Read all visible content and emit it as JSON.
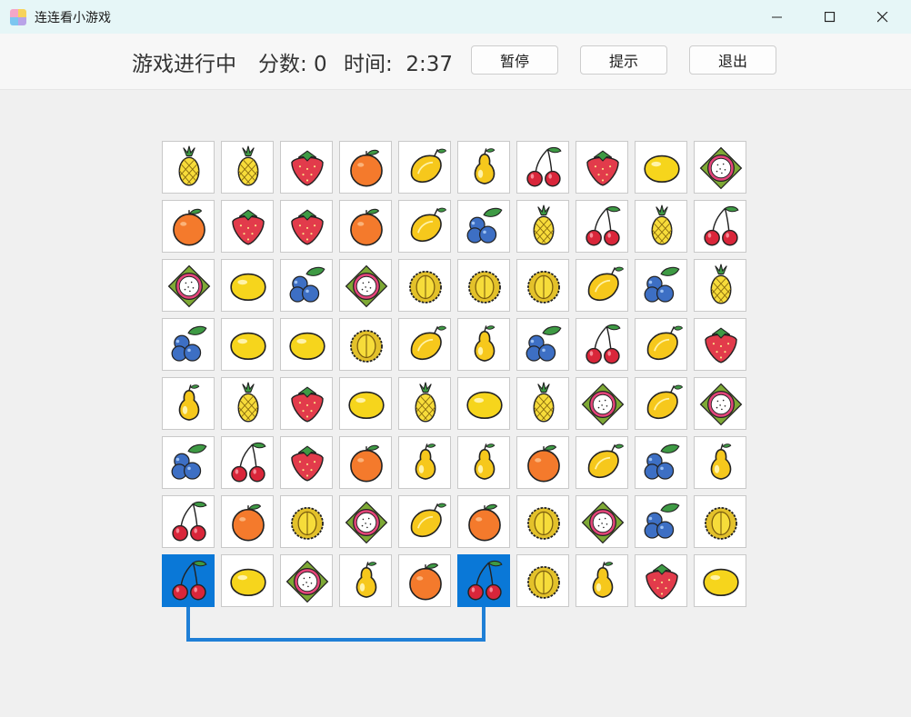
{
  "window": {
    "title": "连连看小游戏",
    "icon": "colorful-grid-app-icon"
  },
  "toolbar": {
    "status": "游戏进行中",
    "score_label": "分数: 0",
    "time_label": "时间:  2:37",
    "pause_label": "暂停",
    "hint_label": "提示",
    "quit_label": "退出"
  },
  "colors": {
    "selection": "#0a78d7",
    "connector": "#1f7fd6"
  },
  "board": {
    "rows": [
      [
        "pineapple",
        "pineapple",
        "strawberry",
        "orange",
        "mango",
        "pear",
        "cherry",
        "strawberry",
        "lemon",
        "dragonfruit"
      ],
      [
        "orange",
        "strawberry",
        "strawberry",
        "orange",
        "mango",
        "blueberry",
        "pineapple",
        "cherry",
        "pineapple",
        "cherry"
      ],
      [
        "dragonfruit",
        "lemon",
        "blueberry",
        "dragonfruit",
        "durian",
        "durian",
        "durian",
        "mango",
        "blueberry",
        "pineapple"
      ],
      [
        "blueberry",
        "lemon",
        "lemon",
        "durian",
        "mango",
        "pear",
        "blueberry",
        "cherry",
        "mango",
        "strawberry"
      ],
      [
        "pear",
        "pineapple",
        "strawberry",
        "lemon",
        "pineapple",
        "lemon",
        "pineapple",
        "dragonfruit",
        "mango",
        "dragonfruit"
      ],
      [
        "blueberry",
        "cherry",
        "strawberry",
        "orange",
        "pear",
        "pear",
        "orange",
        "mango",
        "blueberry",
        "pear"
      ],
      [
        "cherry",
        "orange",
        "durian",
        "dragonfruit",
        "mango",
        "orange",
        "durian",
        "dragonfruit",
        "blueberry",
        "durian"
      ],
      [
        "cherry",
        "lemon",
        "dragonfruit",
        "pear",
        "orange",
        "cherry",
        "durian",
        "pear",
        "strawberry",
        "lemon"
      ]
    ],
    "selected": [
      [
        7,
        0
      ],
      [
        7,
        5
      ]
    ],
    "connection_path": "cherry tile row 8 col 1 to cherry tile row 8 col 6 via below board"
  }
}
